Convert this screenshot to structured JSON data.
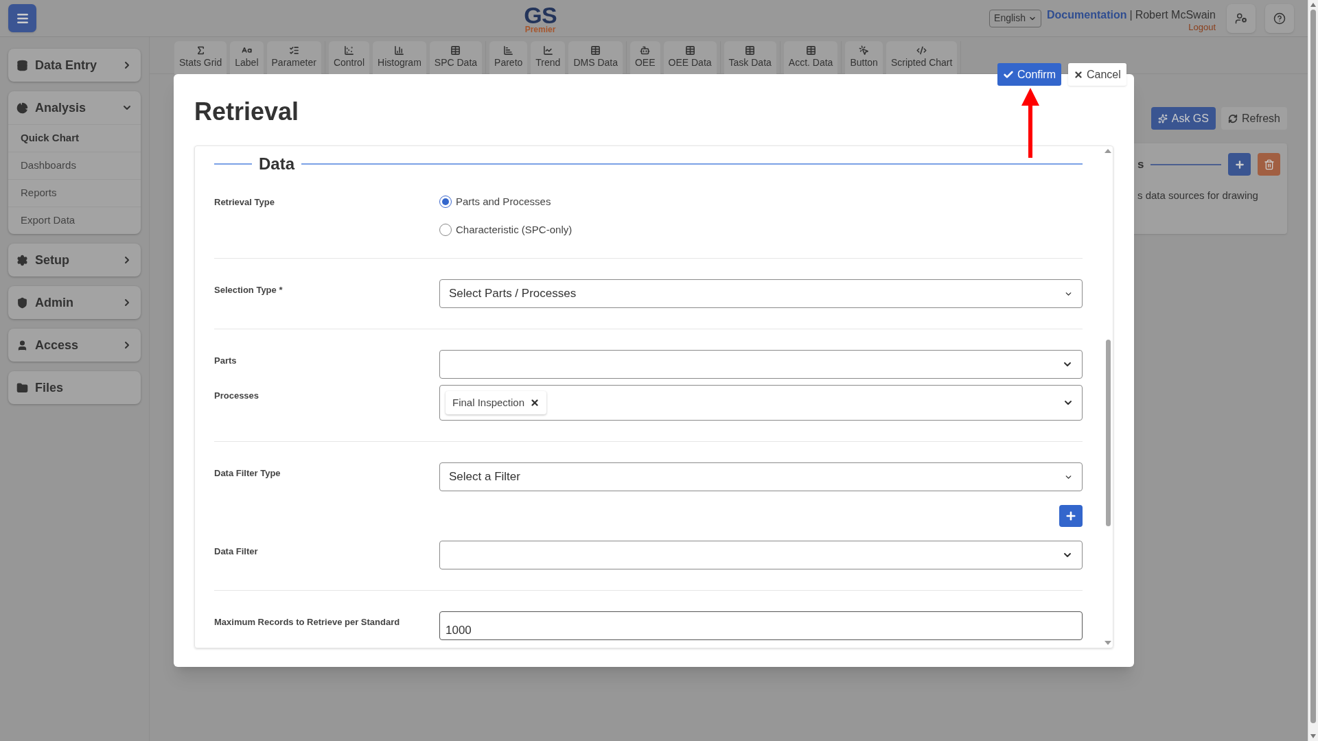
{
  "header": {
    "logo": "GS",
    "logo_sub": "Premier",
    "language": "English",
    "documentation": "Documentation",
    "separator": "|",
    "user": "Robert McSwain",
    "logout": "Logout"
  },
  "sidebar": [
    {
      "label": "Data Entry",
      "expanded": false
    },
    {
      "label": "Analysis",
      "expanded": true,
      "children": [
        {
          "label": "Quick Chart",
          "selected": true
        },
        {
          "label": "Dashboards",
          "selected": false
        },
        {
          "label": "Reports",
          "selected": false
        },
        {
          "label": "Export Data",
          "selected": false
        }
      ]
    },
    {
      "label": "Setup",
      "expanded": false
    },
    {
      "label": "Admin",
      "expanded": false
    },
    {
      "label": "Access",
      "expanded": false
    },
    {
      "label": "Files"
    }
  ],
  "toolbar": [
    [
      "Stats Grid",
      "Label",
      "Parameter"
    ],
    [
      "Control",
      "Histogram",
      "SPC Data"
    ],
    [
      "Pareto",
      "Trend",
      "DMS Data"
    ],
    [
      "OEE",
      "OEE Data"
    ],
    [
      "Task Data"
    ],
    [
      "Acct. Data"
    ],
    [
      "Button",
      "Scripted Chart"
    ]
  ],
  "background": {
    "ask": "Ask GS",
    "refresh": "Refresh",
    "card_heading": "s",
    "card_text": "s data sources for drawing"
  },
  "modal": {
    "title": "Retrieval",
    "confirm": "Confirm",
    "cancel": "Cancel",
    "section": "Data",
    "fields": [
      {
        "kind": "radio",
        "label": "Retrieval Type",
        "options": [
          {
            "label": "Parts and Processes",
            "selected": true
          },
          {
            "label": "Characteristic (SPC-only)",
            "selected": false
          }
        ]
      },
      {
        "kind": "divider"
      },
      {
        "kind": "select",
        "label": "Selection Type *",
        "value": "Select Parts / Processes"
      },
      {
        "kind": "divider"
      },
      {
        "kind": "dropdown",
        "label": "Parts"
      },
      {
        "kind": "multiselect",
        "label": "Processes",
        "tags": [
          "Final Inspection"
        ]
      },
      {
        "kind": "divider"
      },
      {
        "kind": "select",
        "label": "Data Filter Type",
        "value": "Select a Filter"
      },
      {
        "kind": "add_button"
      },
      {
        "kind": "dropdown",
        "label": "Data Filter"
      },
      {
        "kind": "divider"
      },
      {
        "kind": "input",
        "label": "Maximum Records to Retrieve per Standard",
        "value": "1000"
      }
    ]
  }
}
